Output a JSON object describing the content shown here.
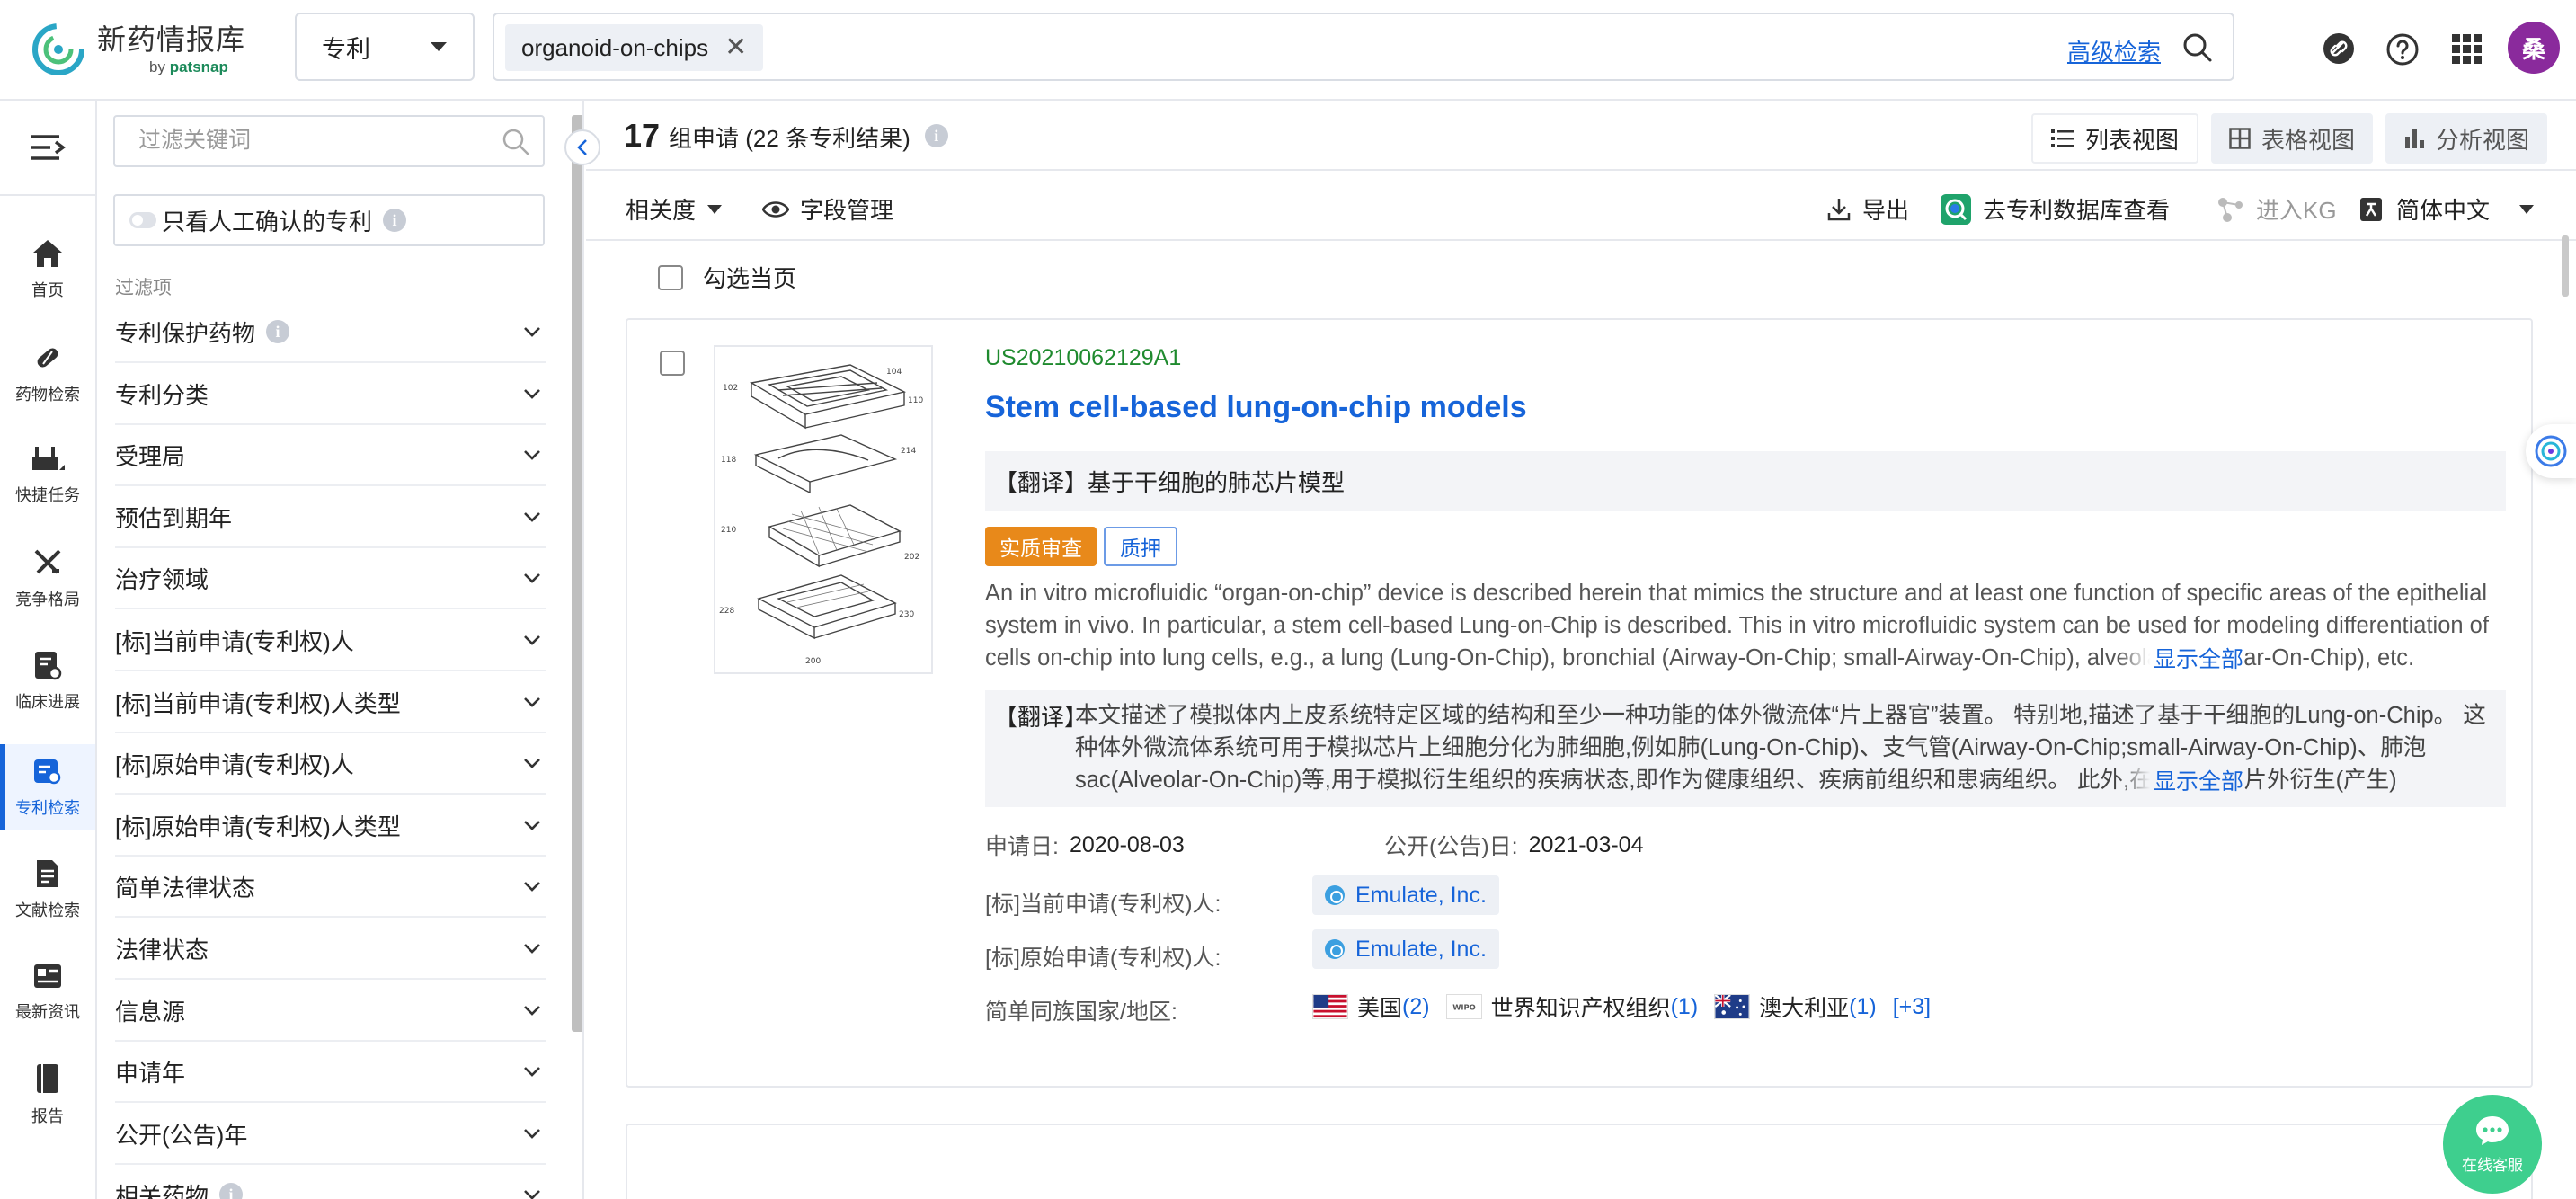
{
  "header": {
    "logo_title": "新药情报库",
    "logo_sub_prefix": "by ",
    "logo_sub_brand": "patsnap",
    "type_select": "专利",
    "search_tag": "organoid-on-chips",
    "advanced_search": "高级检索",
    "avatar_initial": "桑",
    "icons": [
      "link-icon",
      "help-icon",
      "apps-grid-icon"
    ]
  },
  "nav": {
    "items": [
      {
        "label": "首页",
        "icon": "home-icon"
      },
      {
        "label": "药物检索",
        "icon": "pill-icon"
      },
      {
        "label": "快捷任务",
        "icon": "task-icon"
      },
      {
        "label": "竞争格局",
        "icon": "swords-icon"
      },
      {
        "label": "临床进展",
        "icon": "clinical-icon"
      },
      {
        "label": "专利检索",
        "icon": "patent-icon",
        "active": true
      },
      {
        "label": "文献检索",
        "icon": "document-icon"
      },
      {
        "label": "最新资讯",
        "icon": "news-icon"
      },
      {
        "label": "报告",
        "icon": "report-icon"
      }
    ]
  },
  "filters": {
    "search_placeholder": "过滤关键词",
    "manual_only": "只看人工确认的专利",
    "section_label": "过滤项",
    "rows": [
      {
        "label": "专利保护药物",
        "info": true
      },
      {
        "label": "专利分类"
      },
      {
        "label": "受理局"
      },
      {
        "label": "预估到期年"
      },
      {
        "label": "治疗领域"
      },
      {
        "label": "[标]当前申请(专利权)人"
      },
      {
        "label": "[标]当前申请(专利权)人类型"
      },
      {
        "label": "[标]原始申请(专利权)人"
      },
      {
        "label": "[标]原始申请(专利权)人类型"
      },
      {
        "label": "简单法律状态"
      },
      {
        "label": "法律状态"
      },
      {
        "label": "信息源"
      },
      {
        "label": "申请年"
      },
      {
        "label": "公开(公告)年"
      },
      {
        "label": "相关药物",
        "info": true
      }
    ]
  },
  "results": {
    "count": "17",
    "count_text": "组申请 (22 条专利结果)",
    "views": [
      "列表视图",
      "表格视图",
      "分析视图"
    ],
    "active_view": 0,
    "toolbar": {
      "sort": "相关度",
      "fields": "字段管理",
      "export": "导出",
      "to_db": "去专利数据库查看",
      "kg": "进入KG",
      "language": "简体中文"
    },
    "select_page": "勾选当页"
  },
  "card": {
    "pub_no": "US20210062129A1",
    "title": "Stem cell-based lung-on-chip models",
    "translation_label": "【翻译】",
    "title_translation": "基于干细胞的肺芯片模型",
    "badges": [
      "实质审查",
      "质押"
    ],
    "abstract": "An in vitro microfluidic “organ-on-chip” device is described herein that mimics the structure and at least one function of specific areas of the epithelial system in vivo. In particular, a stem cell-based Lung-on-Chip is described. This in vitro microfluidic system can be used for modeling differentiation of cells on-chip into lung cells, e.g., a lung (Lung-On-Chip), bronchial (Airway-On-Chip; small-Airway-On-Chip), alveolar (Alveolar-On-Chip), etc.",
    "show_all": "显示全部",
    "abstract_translation": "本文描述了模拟体内上皮系统特定区域的结构和至少一种功能的体外微流体“片上器官”装置。 特别地,描述了基于干细胞的Lung-on-Chip。 这种体外微流体系统可用于模拟芯片上细胞分化为肺细胞,例如肺(Lung-On-Chip)、支气管(Airway-On-Chip;small-Airway-On-Chip)、肺泡sac(Alveolar-On-Chip)等,用于模拟衍生组织的疾病状态,即作为健康组织、疾病前组织和患病组织。 此外,在用于在芯片外衍生(产生)",
    "application_date_label": "申请日:",
    "application_date": "2020-08-03",
    "publication_date_label": "公开(公告)日:",
    "publication_date": "2021-03-04",
    "current_assignee_label": "[标]当前申请(专利权)人:",
    "current_assignee": "Emulate, Inc.",
    "original_assignee_label": "[标]原始申请(专利权)人:",
    "original_assignee": "Emulate, Inc.",
    "family_label": "简单同族国家/地区:",
    "family": [
      {
        "name": "美国",
        "count": "(2)",
        "flag": "us-flag-icon"
      },
      {
        "name": "世界知识产权组织",
        "count": "(1)",
        "flag": "wipo-icon"
      },
      {
        "name": "澳大利亚",
        "count": "(1)",
        "flag": "au-flag-icon"
      }
    ],
    "family_more": "[+3]"
  },
  "chat": {
    "label": "在线客服"
  }
}
